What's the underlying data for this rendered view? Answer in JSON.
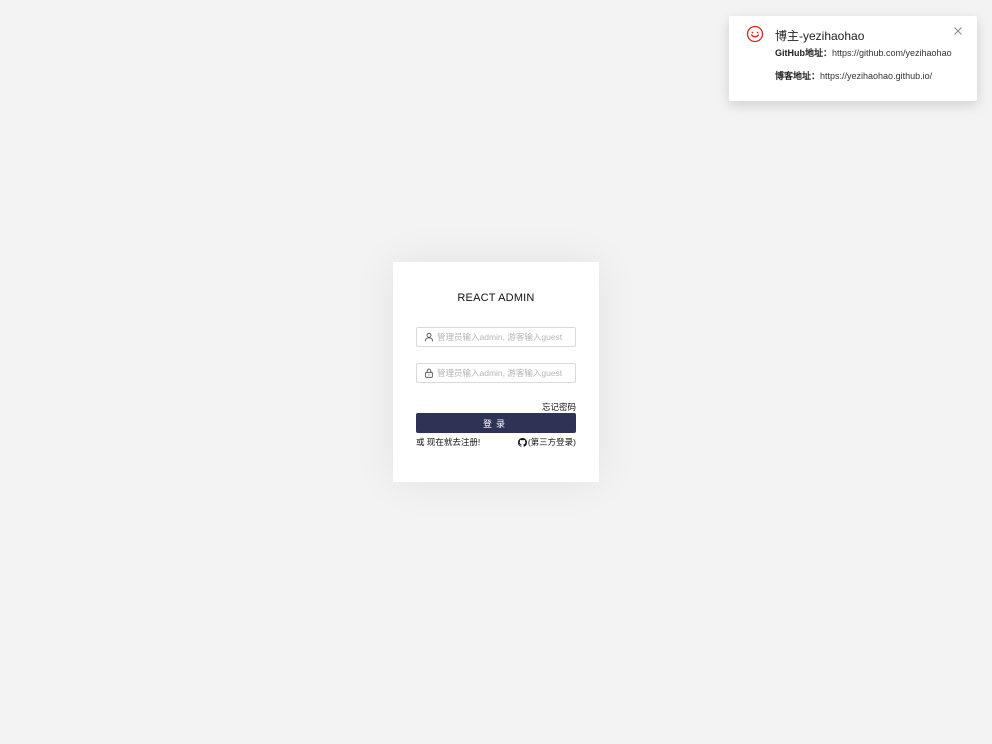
{
  "notification": {
    "title": "博主-yezihaohao",
    "github_label": "GitHub地址：",
    "github_url": "https://github.com/yezihaohao",
    "blog_label": "博客地址：",
    "blog_url": "https://yezihaohao.github.io/",
    "icon": "smile-icon",
    "close_icon": "close-icon",
    "icon_color": "#e0241b"
  },
  "login": {
    "title": "REACT ADMIN",
    "username": {
      "placeholder": "管理员输入admin, 游客输入guest",
      "value": "",
      "icon": "user-icon"
    },
    "password": {
      "placeholder": "管理员输入admin, 游客输入guest",
      "value": "",
      "icon": "lock-icon"
    },
    "forgot_label": "忘记密码",
    "submit_label": "登录",
    "register_prefix": "或 ",
    "register_label": "现在就去注册!",
    "thirdparty_label": "(第三方登录)",
    "thirdparty_icon": "github-icon",
    "button_color": "#2e3356"
  }
}
